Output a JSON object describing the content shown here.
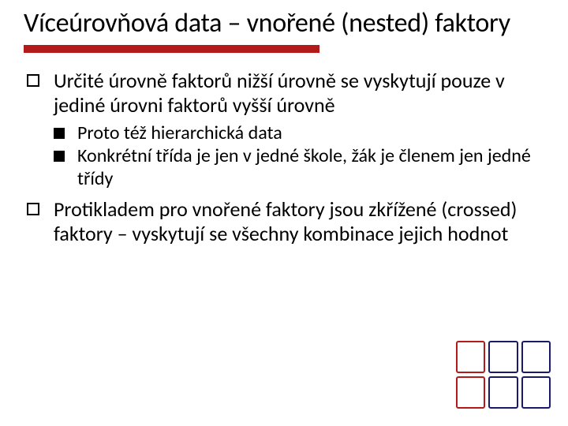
{
  "title": "Víceúrovňová data – vnořené (nested) faktory",
  "bullets": [
    {
      "text": "Určité úrovně faktorů nižší úrovně se vyskytují pouze v jediné úrovni faktorů vyšší úrovně",
      "sub": [
        {
          "text": "Proto též hierarchická data"
        },
        {
          "text": "Konkrétní třída je jen v jedné škole, žák je členem jen jedné třídy"
        }
      ]
    },
    {
      "text": "Protikladem pro vnořené faktory jsou zkřížené (crossed) faktory – vyskytují se všechny kombinace jejich hodnot",
      "sub": []
    }
  ]
}
